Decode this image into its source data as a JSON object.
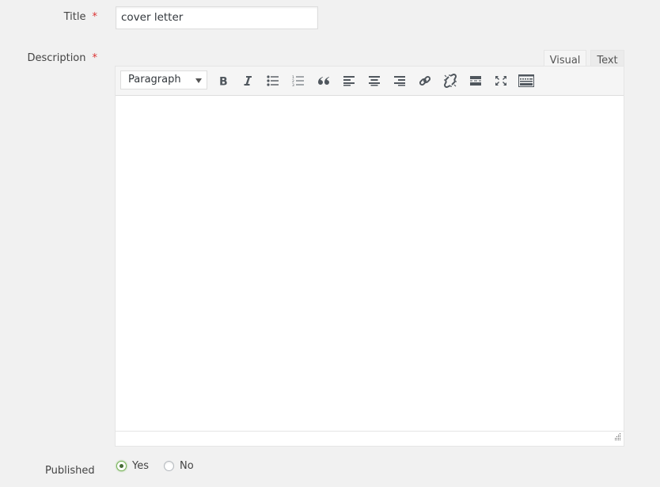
{
  "form": {
    "title": {
      "label": "Title",
      "required_mark": "*",
      "value": "cover letter"
    },
    "description": {
      "label": "Description",
      "required_mark": "*",
      "tabs": [
        {
          "label": "Visual",
          "active": true
        },
        {
          "label": "Text",
          "active": false
        }
      ],
      "toolbar": {
        "format_select": "Paragraph",
        "buttons": [
          "bold",
          "italic",
          "bulleted-list",
          "numbered-list",
          "blockquote",
          "align-left",
          "align-center",
          "align-right",
          "insert-link",
          "remove-link",
          "read-more",
          "fullscreen",
          "toolbar-toggle"
        ]
      },
      "content": ""
    },
    "published": {
      "label": "Published",
      "options": [
        {
          "label": "Yes",
          "checked": true
        },
        {
          "label": "No",
          "checked": false
        }
      ]
    }
  }
}
